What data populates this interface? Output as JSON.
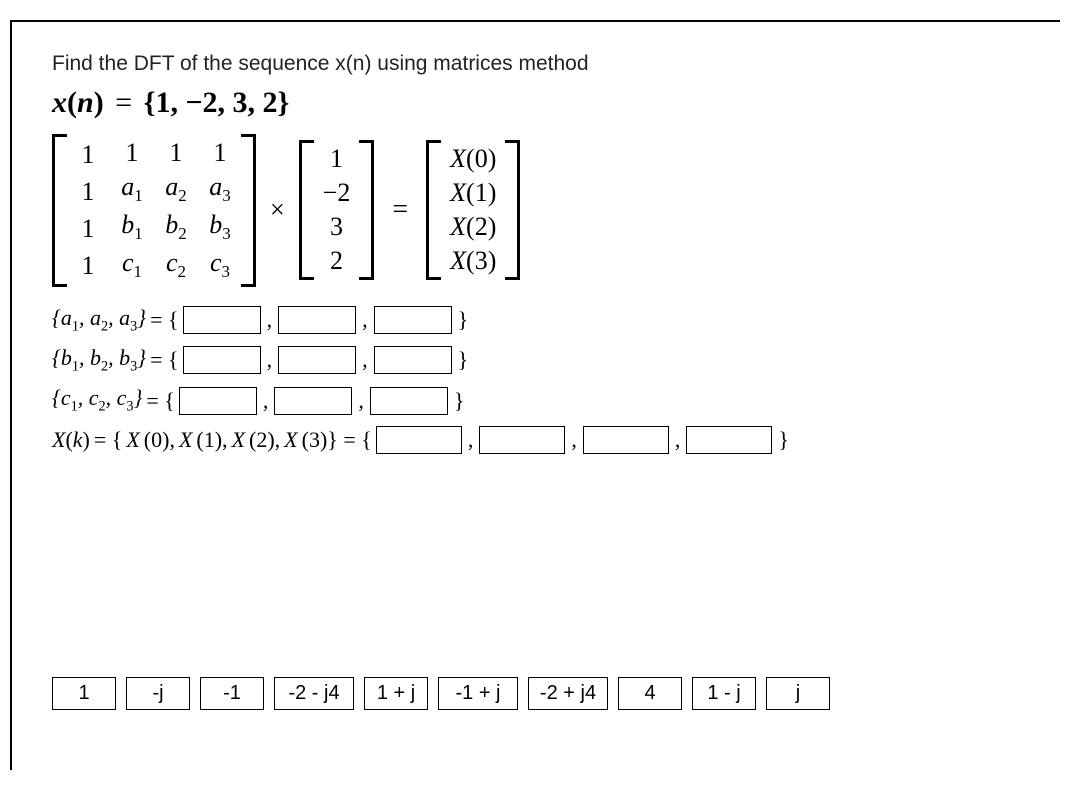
{
  "question": "Find the DFT of the sequence x(n) using matrices method",
  "xn": {
    "var": "x",
    "arg": "n",
    "values": [
      "1",
      "−2",
      "3",
      "2"
    ]
  },
  "matrix": {
    "W": [
      [
        "1",
        "1",
        "1",
        "1"
      ],
      [
        "1",
        "a₁",
        "a₂",
        "a₃"
      ],
      [
        "1",
        "b₁",
        "b₂",
        "b₃"
      ],
      [
        "1",
        "c₁",
        "c₂",
        "c₃"
      ]
    ],
    "x": [
      "1",
      "−2",
      "3",
      "2"
    ],
    "X": [
      "X(0)",
      "X(1)",
      "X(2)",
      "X(3)"
    ]
  },
  "times": "×",
  "equals": "=",
  "rows": {
    "a": "{a₁, a₂, a₃} = {",
    "b": "{b₁, b₂, b₃} = {",
    "c": "{c₁, c₂, c₃} = {",
    "xk_pre": "X(k) = {X(0), X(1), X(2), X(3)} = {",
    "close": "}"
  },
  "choices": [
    "1",
    "-j",
    "-1",
    "-2 - j4",
    "1 + j",
    "-1 + j",
    "-2 + j4",
    "4",
    "1 - j",
    "j"
  ]
}
